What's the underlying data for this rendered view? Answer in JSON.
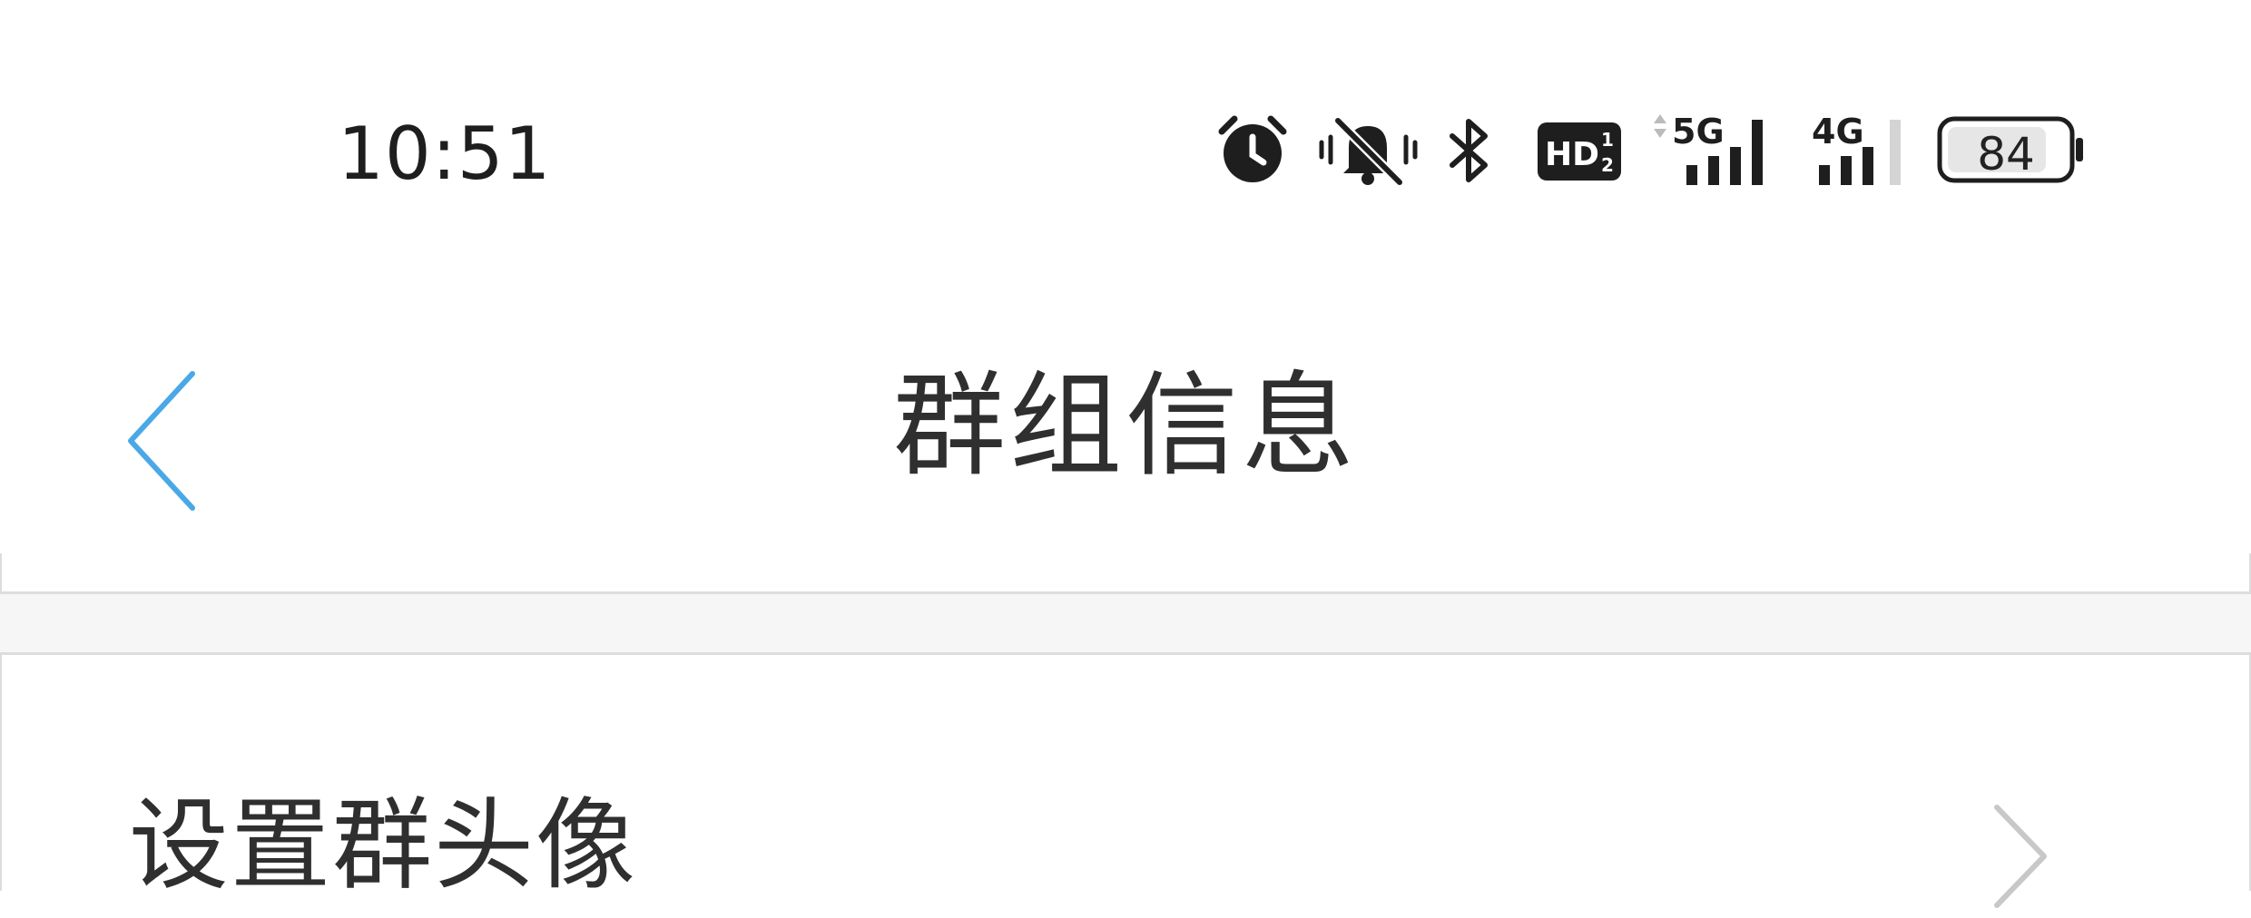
{
  "status_bar": {
    "time": "10:51",
    "icons": [
      "alarm-icon",
      "muted-bell-icon",
      "bluetooth-icon",
      "hd-voice-icon",
      "signal-5g-icon",
      "signal-4g-icon",
      "battery-icon"
    ],
    "hd_label": "HD",
    "hd_sub_top": "1",
    "hd_sub_bottom": "2",
    "net_5g": "5G",
    "net_4g": "4G",
    "battery_level": "84",
    "battery_fraction": 0.84
  },
  "header": {
    "title": "群组信息",
    "back_icon": "chevron-left-icon",
    "accent_color": "#4aa8e6"
  },
  "list": {
    "items": [
      {
        "label": "设置群头像",
        "icon": "chevron-right-icon"
      }
    ]
  },
  "colors": {
    "text": "#2f2f2f",
    "divider": "#dddddd",
    "section_gap": "#f6f6f6",
    "chevron": "#c8c8c8"
  }
}
